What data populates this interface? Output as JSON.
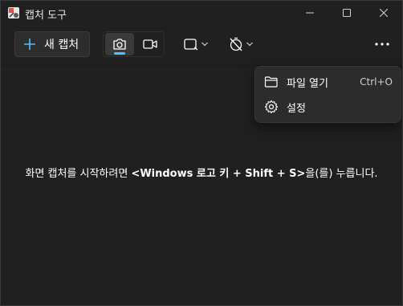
{
  "window": {
    "title": "캡처 도구",
    "accent_color": "#4cc2ff",
    "background_color": "#202020"
  },
  "toolbar": {
    "new_capture_label": "새 캡처",
    "modes": [
      {
        "name": "camera-icon",
        "selected": true
      },
      {
        "name": "video-camera-icon",
        "selected": false
      }
    ],
    "shape_icon": "rectangle-snip-icon",
    "timer_icon": "timer-off-icon",
    "more_icon": "ellipsis-icon"
  },
  "main": {
    "message_prefix": "화면 캡처를 시작하려면 ",
    "message_shortcut": "<Windows 로고 키 + Shift + S>",
    "message_suffix": "을(를) 누릅니다."
  },
  "menu": {
    "items": [
      {
        "label": "파일 열기",
        "shortcut": "Ctrl+O",
        "icon": "folder-icon"
      },
      {
        "label": "설정",
        "shortcut": "",
        "icon": "gear-icon"
      }
    ]
  }
}
